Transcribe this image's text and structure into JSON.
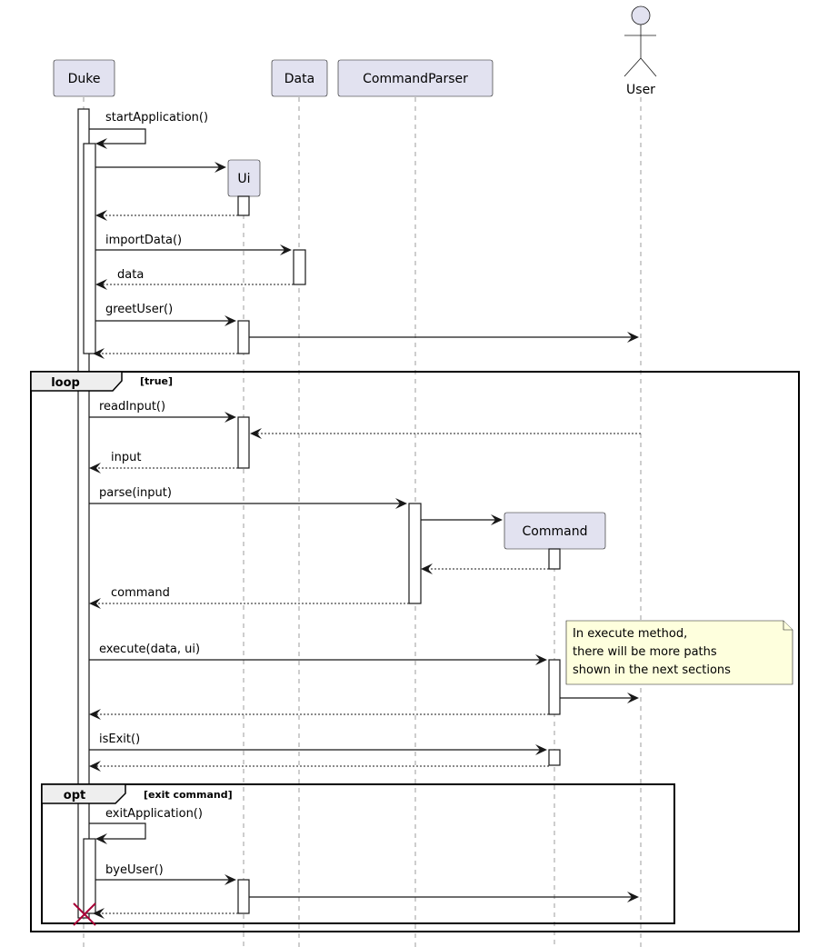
{
  "diagram": {
    "type": "sequence",
    "participants": [
      {
        "id": "duke",
        "label": "Duke",
        "kind": "participant"
      },
      {
        "id": "ui",
        "label": "Ui",
        "kind": "participant",
        "created": true
      },
      {
        "id": "data",
        "label": "Data",
        "kind": "participant"
      },
      {
        "id": "parser",
        "label": "CommandParser",
        "kind": "participant"
      },
      {
        "id": "command",
        "label": "Command",
        "kind": "participant",
        "created": true
      },
      {
        "id": "user",
        "label": "User",
        "kind": "actor"
      }
    ],
    "messages": [
      {
        "from": "duke",
        "to": "duke",
        "label": "startApplication()",
        "style": "sync"
      },
      {
        "from": "duke",
        "to": "ui",
        "label": "",
        "style": "create"
      },
      {
        "from": "ui",
        "to": "duke",
        "label": "",
        "style": "return"
      },
      {
        "from": "duke",
        "to": "data",
        "label": "importData()",
        "style": "sync"
      },
      {
        "from": "data",
        "to": "duke",
        "label": "data",
        "style": "return"
      },
      {
        "from": "duke",
        "to": "ui",
        "label": "greetUser()",
        "style": "sync"
      },
      {
        "from": "ui",
        "to": "user",
        "label": "",
        "style": "sync"
      },
      {
        "from": "ui",
        "to": "duke",
        "label": "",
        "style": "return"
      },
      {
        "from": "duke",
        "to": "ui",
        "label": "readInput()",
        "style": "sync"
      },
      {
        "from": "user",
        "to": "ui",
        "label": "",
        "style": "return"
      },
      {
        "from": "ui",
        "to": "duke",
        "label": "input",
        "style": "return"
      },
      {
        "from": "duke",
        "to": "parser",
        "label": "parse(input)",
        "style": "sync"
      },
      {
        "from": "parser",
        "to": "command",
        "label": "",
        "style": "create"
      },
      {
        "from": "command",
        "to": "parser",
        "label": "",
        "style": "return"
      },
      {
        "from": "parser",
        "to": "duke",
        "label": "command",
        "style": "return"
      },
      {
        "from": "duke",
        "to": "command",
        "label": "execute(data, ui)",
        "style": "sync"
      },
      {
        "from": "command",
        "to": "user",
        "label": "",
        "style": "sync"
      },
      {
        "from": "command",
        "to": "duke",
        "label": "",
        "style": "return"
      },
      {
        "from": "duke",
        "to": "command",
        "label": "isExit()",
        "style": "sync"
      },
      {
        "from": "command",
        "to": "duke",
        "label": "",
        "style": "return"
      },
      {
        "from": "duke",
        "to": "duke",
        "label": "exitApplication()",
        "style": "sync"
      },
      {
        "from": "duke",
        "to": "ui",
        "label": "byeUser()",
        "style": "sync"
      },
      {
        "from": "ui",
        "to": "user",
        "label": "",
        "style": "sync"
      },
      {
        "from": "ui",
        "to": "duke",
        "label": "",
        "style": "return"
      }
    ],
    "fragments": [
      {
        "kind": "loop",
        "label": "loop",
        "guard": "[true]"
      },
      {
        "kind": "opt",
        "label": "opt",
        "guard": "[exit command]"
      }
    ],
    "note": {
      "lines": [
        "In execute method,",
        "there will be more paths",
        "shown in the next sections"
      ]
    },
    "destroyed": "duke"
  }
}
